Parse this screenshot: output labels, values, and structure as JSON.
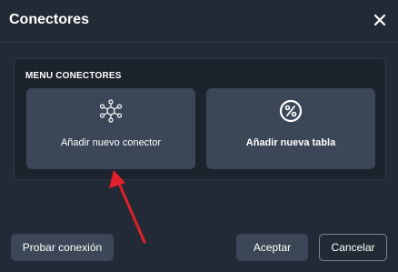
{
  "dialog": {
    "title": "Conectores",
    "close_icon": "close-icon"
  },
  "panel": {
    "label": "MENU CONECTORES",
    "cards": [
      {
        "label": "Añadir nuevo conector",
        "icon": "network-nodes-icon"
      },
      {
        "label": "Añadir nueva tabla",
        "icon": "percent-circle-icon"
      }
    ]
  },
  "footer": {
    "test_label": "Probar conexión",
    "accept_label": "Aceptar",
    "cancel_label": "Cancelar"
  },
  "annotation": {
    "arrow_color": "#e0202a"
  }
}
